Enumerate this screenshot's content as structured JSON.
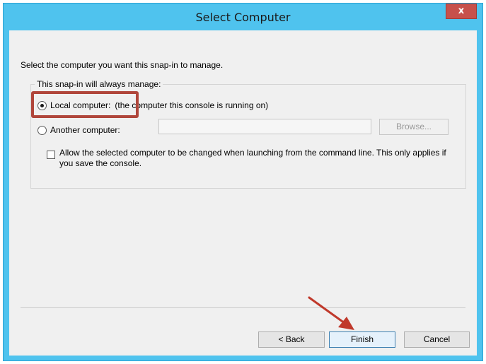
{
  "dialog": {
    "title": "Select Computer",
    "close_label": "x",
    "intro": "Select the computer you want this snap-in to manage.",
    "group_caption": "This snap-in will always manage:",
    "local_label": "Local computer:",
    "local_desc": "(the computer this console is running on)",
    "local_selected": true,
    "another_label": "Another computer:",
    "another_selected": false,
    "computer_name_value": "",
    "browse_label": "Browse...",
    "allow_change_text": "Allow the selected computer to be changed when launching from the command line.  This only applies if you save the console.",
    "allow_change_checked": false
  },
  "footer": {
    "back_label": "< Back",
    "finish_label": "Finish",
    "cancel_label": "Cancel"
  },
  "colors": {
    "titlebar": "#4fc3ee",
    "close_button": "#c7504b",
    "annotation": "#b0463b"
  },
  "icons": [
    "close-icon",
    "radio-button-icon",
    "checkbox-icon",
    "annotation-arrow-icon"
  ]
}
